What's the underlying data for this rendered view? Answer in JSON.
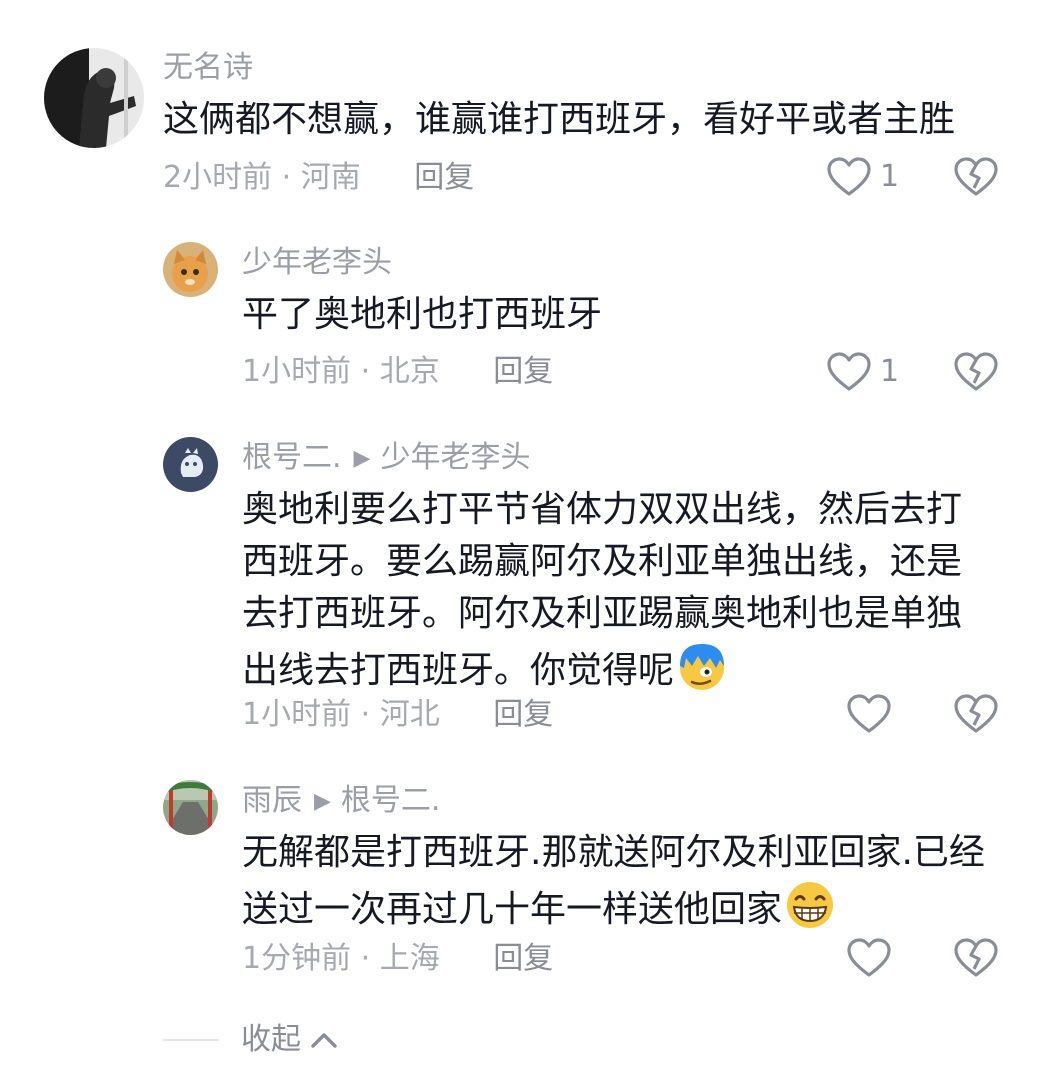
{
  "comments": [
    {
      "user": "无名诗",
      "text": "这俩都不想赢，谁赢谁打西班牙，看好平或者主胜",
      "time": "2小时前",
      "location": "河南",
      "reply": "回复",
      "likes": "1"
    },
    {
      "user": "少年老李头",
      "text": "平了奥地利也打西班牙",
      "time": "1小时前",
      "location": "北京",
      "reply": "回复",
      "likes": "1"
    },
    {
      "user": "根号二.",
      "reply_to": "少年老李头",
      "text_lines": [
        "奥地利要么打平节省体力双双出线，然后去打",
        "西班牙。要么踢赢阿尔及利亚单独出线，还是",
        "去打西班牙。阿尔及利亚踢赢奥地利也是单独",
        "出线去打西班牙。你觉得呢"
      ],
      "emoji": "blue-hair-smirk-emoji",
      "time": "1小时前",
      "location": "河北",
      "reply": "回复"
    },
    {
      "user": "雨辰",
      "reply_to": "根号二.",
      "text_lines": [
        "无解都是打西班牙.那就送阿尔及利亚回家.已经",
        "送过一次再过几十年一样送他回家"
      ],
      "emoji": "grinning-teeth-emoji",
      "time": "1分钟前",
      "location": "上海",
      "reply": "回复"
    }
  ],
  "separator": "·",
  "collapse_label": "收起",
  "colors": {
    "text": "#161823",
    "meta": "#a7a9b0",
    "username": "#9b9ea6"
  }
}
